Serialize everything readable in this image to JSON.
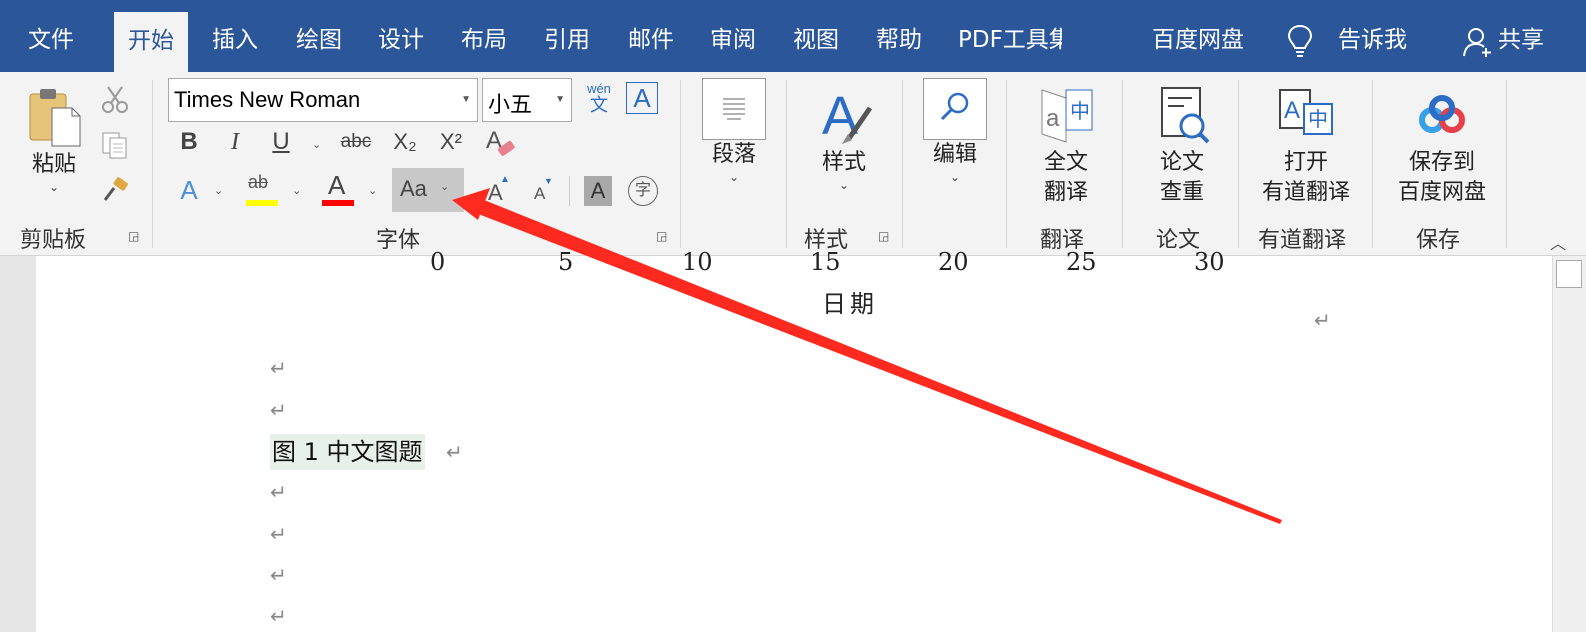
{
  "tabs": {
    "file": "文件",
    "home": "开始",
    "insert": "插入",
    "draw": "绘图",
    "design": "设计",
    "layout": "布局",
    "references": "引用",
    "mailings": "邮件",
    "review": "审阅",
    "view": "视图",
    "help": "帮助",
    "pdf": "PDF工具集",
    "baidu": "百度网盘",
    "tell_me": "告诉我",
    "share": "共享"
  },
  "clipboard": {
    "paste_label": "粘贴",
    "group_label": "剪贴板"
  },
  "font": {
    "name": "Times New Roman",
    "size": "小五",
    "phonetic_top": "wén",
    "phonetic_bottom": "文",
    "border_char": "A",
    "bold": "B",
    "italic": "I",
    "underline": "U",
    "strike": "abc",
    "subscript": "X₂",
    "superscript": "X²",
    "effects": "A",
    "highlight": "ab",
    "font_color": "A",
    "change_case": "Aa",
    "grow": "A",
    "shrink": "A",
    "shading": "A",
    "enclose": "字",
    "group_label": "字体"
  },
  "paragraph": {
    "label": "段落"
  },
  "styles": {
    "label": "样式",
    "group_label": "样式"
  },
  "editing": {
    "label": "编辑"
  },
  "translate": {
    "label_1": "全文",
    "label_2": "翻译",
    "group_label": "翻译"
  },
  "paper": {
    "label_1": "论文",
    "label_2": "查重",
    "group_label": "论文"
  },
  "youdao": {
    "label_1": "打开",
    "label_2": "有道翻译",
    "group_label": "有道翻译"
  },
  "save": {
    "label_1": "保存到",
    "label_2": "百度网盘",
    "group_label": "保存"
  },
  "document": {
    "axis_ticks": [
      "0",
      "5",
      "10",
      "15",
      "20",
      "25",
      "30"
    ],
    "axis_label": "日期",
    "caption": "图 1  中文图题",
    "para_mark": "↵"
  },
  "colors": {
    "accent": "#2b579a",
    "highlight": "#ffff00",
    "font_color": "#ff0000",
    "annotation_arrow": "#ff2a1f"
  }
}
